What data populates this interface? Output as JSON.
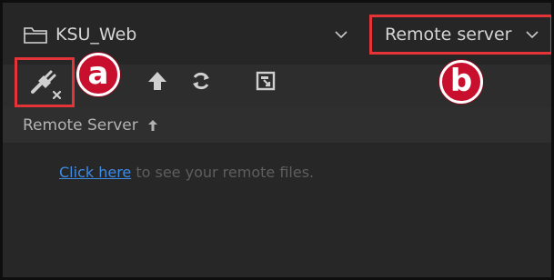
{
  "site_selector": {
    "label": "KSU_Web",
    "folder_icon": "folder-icon",
    "chevron_icon": "chevron-down-icon"
  },
  "view_selector": {
    "label": "Remote server",
    "chevron_icon": "chevron-down-icon"
  },
  "toolbar": {
    "buttons": [
      {
        "name": "connect-to-remote-host-button",
        "icon": "plug-disconnected-icon"
      },
      {
        "name": "put-file-button",
        "icon": "arrow-up-icon"
      },
      {
        "name": "refresh-button",
        "icon": "refresh-icon"
      },
      {
        "name": "expand-view-button",
        "icon": "expand-icon"
      }
    ]
  },
  "callouts": {
    "a": "a",
    "b": "b"
  },
  "panel": {
    "header": "Remote Server",
    "sort_icon": "arrow-up-icon",
    "empty_link": "Click here",
    "empty_rest": " to see your remote files."
  },
  "colors": {
    "highlight": "#e53437",
    "callout": "#c8102e",
    "link": "#3f8be2",
    "panel_bg": "#2d2d2d"
  }
}
